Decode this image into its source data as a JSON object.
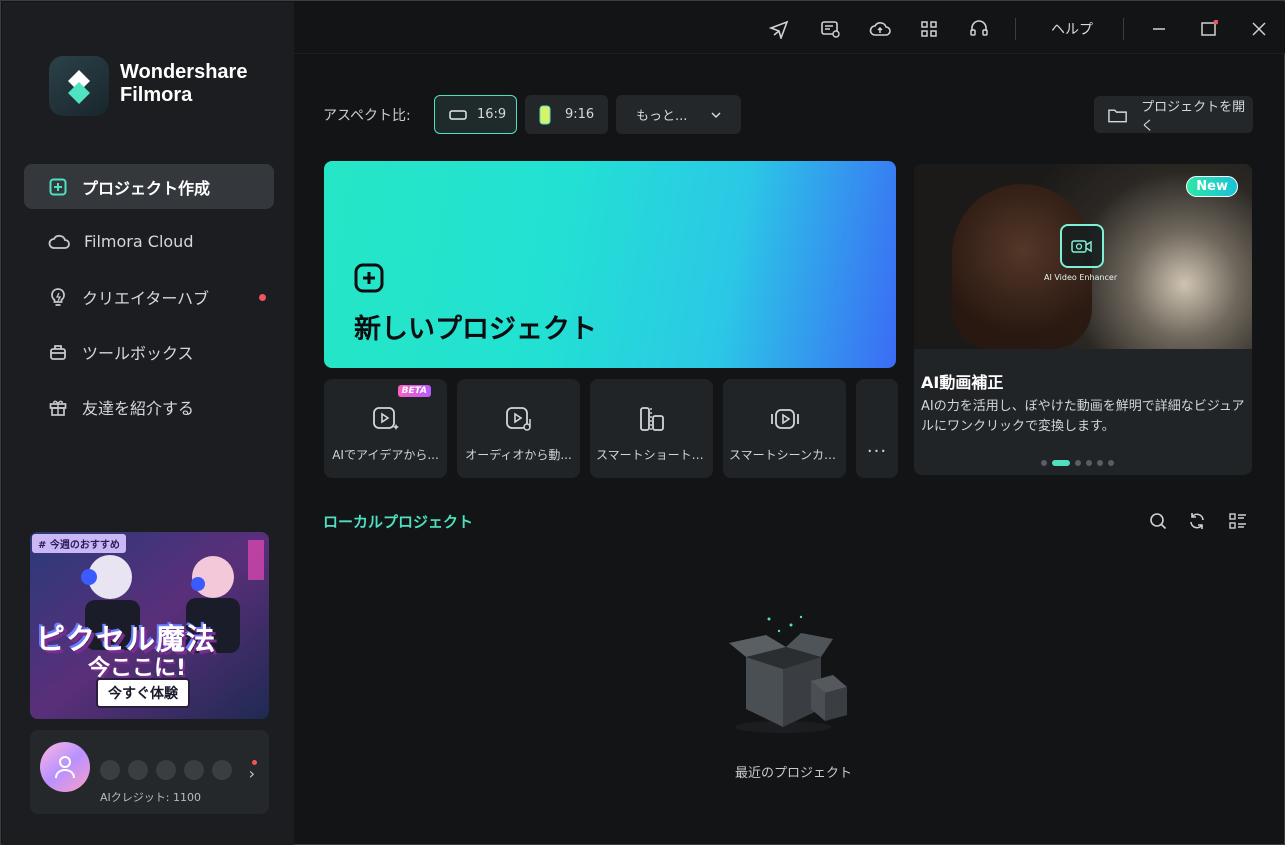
{
  "brand": {
    "line1": "Wondershare",
    "line2": "Filmora"
  },
  "sidebar": {
    "items": [
      {
        "label": "プロジェクト作成",
        "icon": "new-project-icon",
        "active": true
      },
      {
        "label": "Filmora Cloud",
        "icon": "cloud-icon"
      },
      {
        "label": "クリエイターハブ",
        "icon": "lightbulb-icon",
        "notification": true
      },
      {
        "label": "ツールボックス",
        "icon": "toolbox-icon"
      },
      {
        "label": "友達を紹介する",
        "icon": "gift-icon"
      }
    ],
    "promo": {
      "tag": "# 今週のおすすめ",
      "title": "ピクセル魔法",
      "subtitle": "今ここに!",
      "button": "今すぐ体験"
    },
    "user": {
      "credits": "AIクレジット: 1100"
    }
  },
  "topbar": {
    "icons": [
      "send-icon",
      "messages-icon",
      "cloud-upload-icon",
      "grid-icon",
      "headset-icon"
    ],
    "help": "ヘルプ"
  },
  "aspect": {
    "label": "アスペクト比:",
    "options": [
      {
        "label": "16:9",
        "selected": true
      },
      {
        "label": "9:16"
      }
    ],
    "more": "もっと..."
  },
  "open_project": "プロジェクトを開く",
  "new_project": {
    "title": "新しいプロジェクト"
  },
  "tools": [
    {
      "label": "AIでアイデアから...",
      "badge": "BETA",
      "icon": "ai-idea-icon"
    },
    {
      "label": "オーディオから動...",
      "icon": "audio-to-video-icon"
    },
    {
      "label": "スマートショートク...",
      "icon": "smart-short-clip-icon"
    },
    {
      "label": "スマートシーンカット",
      "icon": "smart-scene-cut-icon"
    }
  ],
  "tools_more": "...",
  "feature": {
    "badge": "New",
    "overlay_label": "AI Video Enhancer",
    "title": "AI動画補正",
    "description": "AIの力を活用し、ぼやけた動画を鮮明で詳細なビジュアルにワンクリックで変換します。",
    "slides": 6,
    "active_slide": 2
  },
  "local": {
    "title": "ローカルプロジェクト",
    "empty_label": "最近のプロジェクト"
  },
  "colors": {
    "accent": "#4ee0c0",
    "background": "#121416",
    "sidebar": "#1b1d20"
  }
}
